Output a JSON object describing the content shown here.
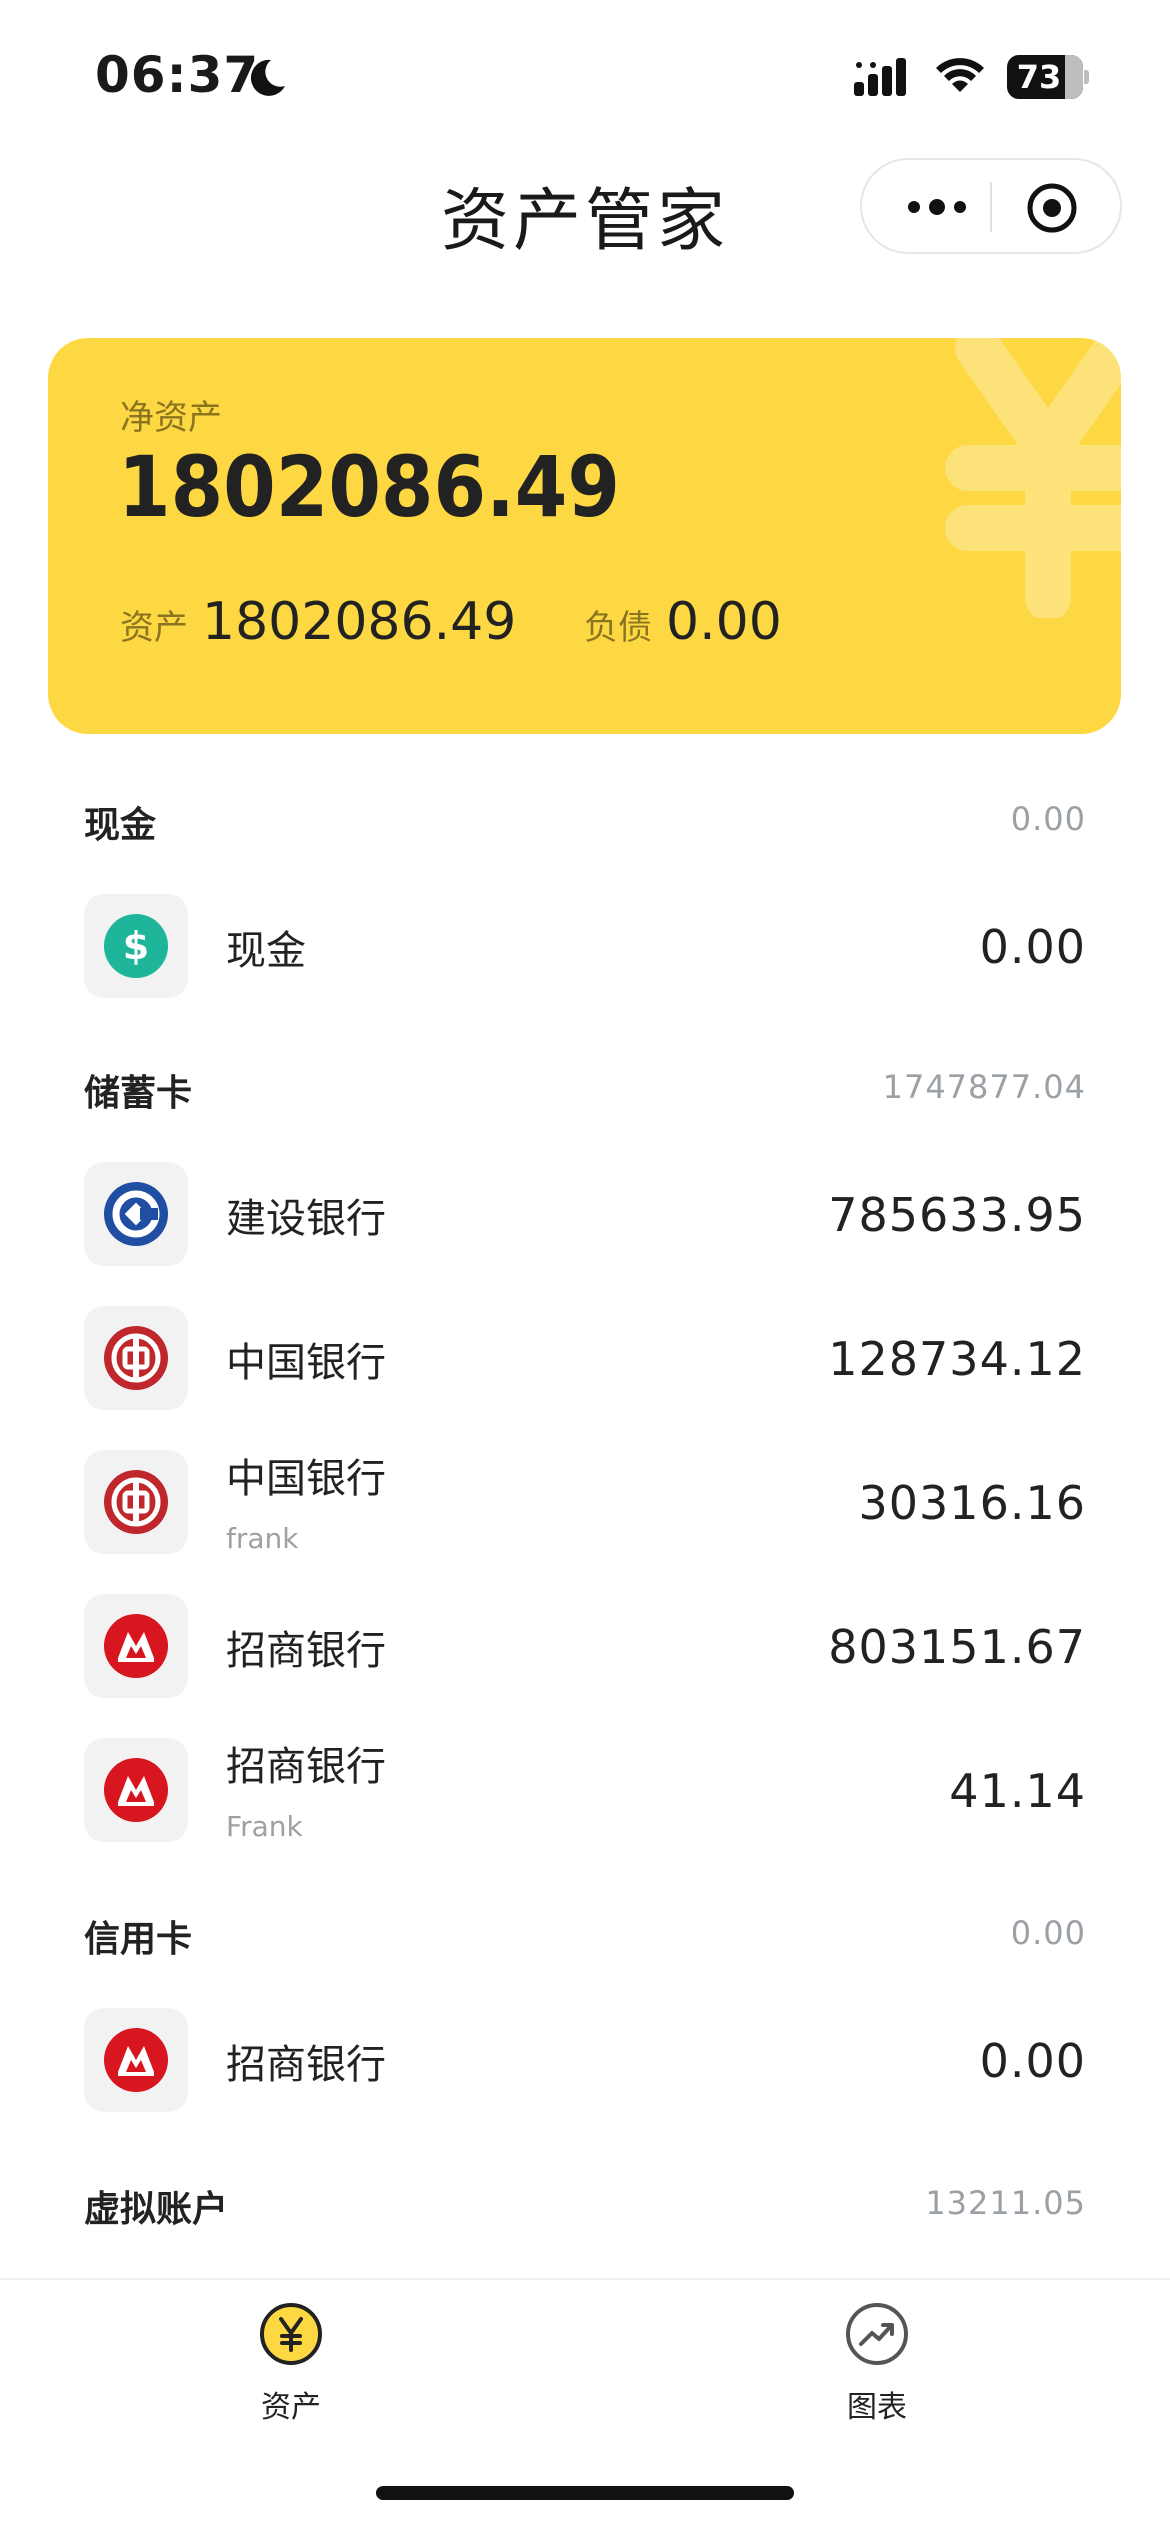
{
  "status_bar": {
    "time": "06:37",
    "battery": "73"
  },
  "nav": {
    "title": "资产管家"
  },
  "summary": {
    "net_label": "净资产",
    "net_value": "1802086.49",
    "assets_label": "资产",
    "assets_value": "1802086.49",
    "liabilities_label": "负债",
    "liabilities_value": "0.00",
    "accent_color": "#fdd843"
  },
  "sections": {
    "cash": {
      "title": "现金",
      "total": "0.00",
      "items": [
        {
          "name": "现金",
          "amount": "0.00",
          "icon": "dollar-icon"
        }
      ]
    },
    "debit": {
      "title": "储蓄卡",
      "total": "1747877.04",
      "items": [
        {
          "name": "建设银行",
          "amount": "785633.95",
          "icon": "ccb-icon"
        },
        {
          "name": "中国银行",
          "amount": "128734.12",
          "icon": "boc-icon"
        },
        {
          "name": "中国银行",
          "sub": "frank",
          "amount": "30316.16",
          "icon": "boc-icon"
        },
        {
          "name": "招商银行",
          "amount": "803151.67",
          "icon": "cmb-icon"
        },
        {
          "name": "招商银行",
          "sub": "Frank",
          "amount": "41.14",
          "icon": "cmb-icon"
        }
      ]
    },
    "credit": {
      "title": "信用卡",
      "total": "0.00",
      "items": [
        {
          "name": "招商银行",
          "amount": "0.00",
          "icon": "cmb-icon"
        }
      ]
    },
    "virtual": {
      "title": "虚拟账户",
      "total": "13211.05"
    }
  },
  "tabbar": {
    "assets_label": "资产",
    "charts_label": "图表"
  }
}
